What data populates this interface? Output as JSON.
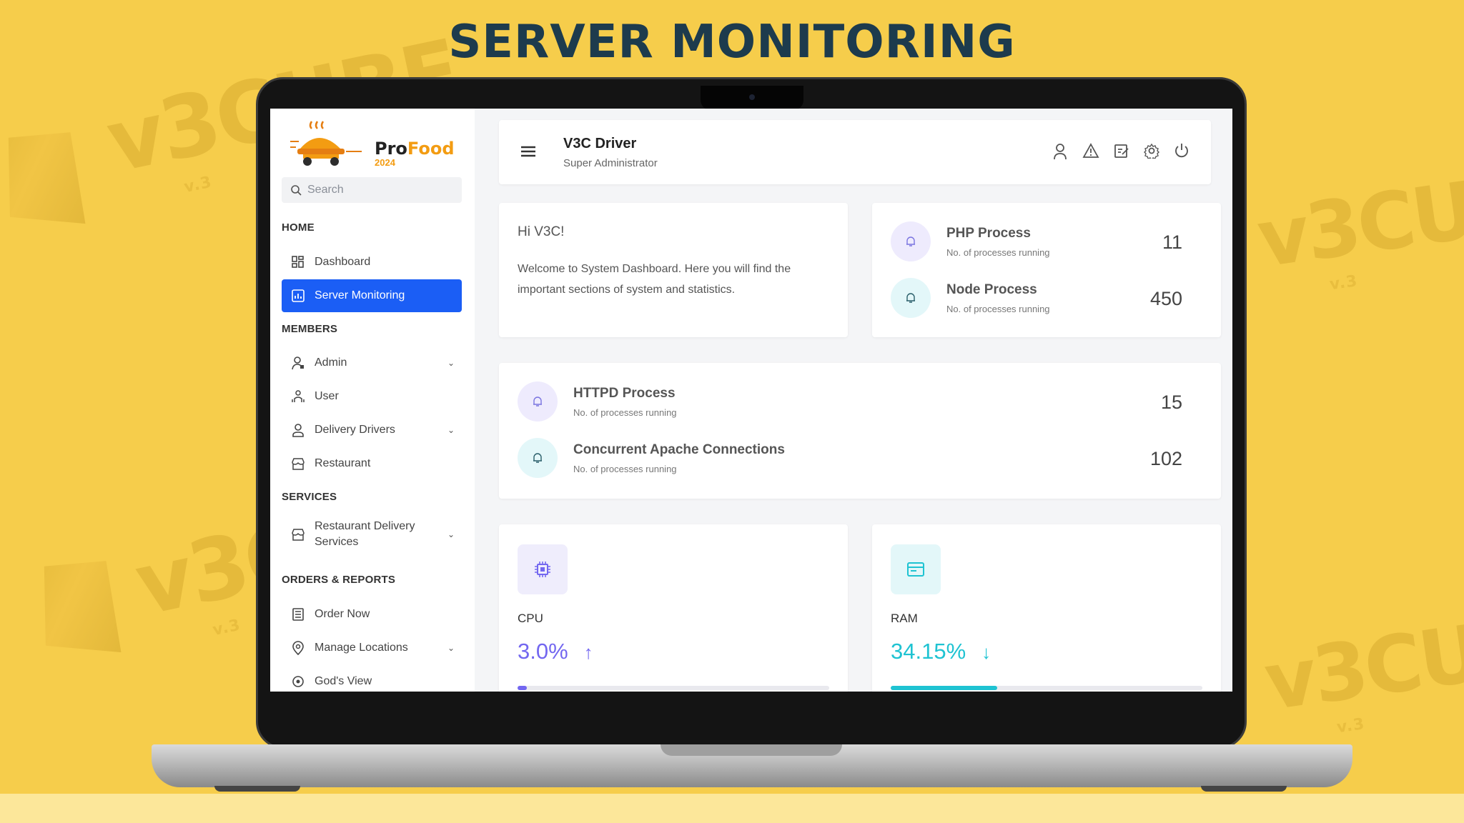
{
  "banner": {
    "title": "SERVER MONITORING"
  },
  "watermark": {
    "text": "v3CUBE",
    "sub": "v.3"
  },
  "logo": {
    "name_pro": "Pro",
    "name_food": "Food",
    "year": "2024"
  },
  "sidebar": {
    "search_placeholder": "Search",
    "sections": {
      "home": "HOME",
      "members": "MEMBERS",
      "services": "SERVICES",
      "orders": "ORDERS & REPORTS"
    },
    "items": [
      {
        "label": "Dashboard",
        "icon": "dashboard-icon"
      },
      {
        "label": "Server Monitoring",
        "icon": "chart-icon",
        "active": true
      },
      {
        "label": "Admin",
        "icon": "admin-icon",
        "expandable": true
      },
      {
        "label": "User",
        "icon": "users-icon"
      },
      {
        "label": "Delivery Drivers",
        "icon": "driver-icon",
        "expandable": true
      },
      {
        "label": "Restaurant",
        "icon": "store-icon"
      },
      {
        "label": "Restaurant Delivery Services",
        "icon": "store-icon",
        "expandable": true
      },
      {
        "label": "Order Now",
        "icon": "list-icon"
      },
      {
        "label": "Manage Locations",
        "icon": "location-icon",
        "expandable": true
      },
      {
        "label": "God's View",
        "icon": "eye-icon"
      }
    ]
  },
  "header": {
    "user_name": "V3C Driver",
    "user_role": "Super Administrator",
    "icons": [
      "user-icon",
      "warning-icon",
      "edit-icon",
      "settings-icon",
      "power-icon"
    ]
  },
  "welcome": {
    "greeting": "Hi V3C!",
    "message": "Welcome to System Dashboard. Here you will find the important sections of system and statistics."
  },
  "processes": [
    {
      "name": "PHP Process",
      "sub": "No. of processes running",
      "value": "11"
    },
    {
      "name": "Node Process",
      "sub": "No. of processes running",
      "value": "450"
    },
    {
      "name": "HTTPD Process",
      "sub": "No. of processes running",
      "value": "15"
    },
    {
      "name": "Concurrent Apache Connections",
      "sub": "No. of processes running",
      "value": "102"
    }
  ],
  "metrics": [
    {
      "label": "CPU",
      "value": "3.0%",
      "trend": "up",
      "usage": 0.03,
      "color": "#7367f0"
    },
    {
      "label": "RAM",
      "value": "34.15%",
      "trend": "down",
      "usage": 0.3415,
      "color": "#1fc3d2"
    }
  ],
  "colors": {
    "accent": "#1b5ef5",
    "background": "#f6cd4b",
    "title": "#1d3b4d"
  }
}
